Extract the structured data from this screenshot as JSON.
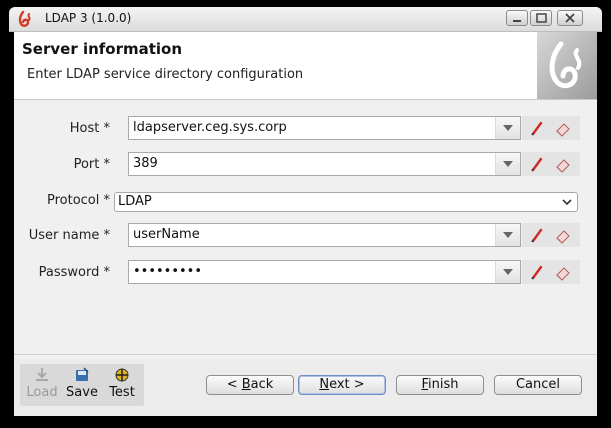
{
  "window": {
    "title": "LDAP 3 (1.0.0)",
    "controls": [
      "minimize",
      "maximize",
      "close"
    ]
  },
  "header": {
    "title": "Server information",
    "subtitle": "Enter LDAP service directory configuration"
  },
  "form": {
    "host": {
      "label": "Host *",
      "value": "ldapserver.ceg.sys.corp"
    },
    "port": {
      "label": "Port *",
      "value": "389"
    },
    "protocol": {
      "label": "Protocol *",
      "value": "LDAP"
    },
    "username": {
      "label": "User name *",
      "value": "userName"
    },
    "password": {
      "label": "Password *",
      "value": "•••••••••"
    }
  },
  "toolbar": {
    "load": "Load",
    "save": "Save",
    "test": "Test"
  },
  "buttons": {
    "back_prefix": "< ",
    "back_mnemonic": "B",
    "back_rest": "ack",
    "next_mnemonic": "N",
    "next_rest": "ext >",
    "finish_mnemonic": "F",
    "finish_rest": "inish",
    "cancel": "Cancel"
  },
  "colors": {
    "accent_red": "#cc2a2a",
    "logo_red": "#d23a2a"
  }
}
